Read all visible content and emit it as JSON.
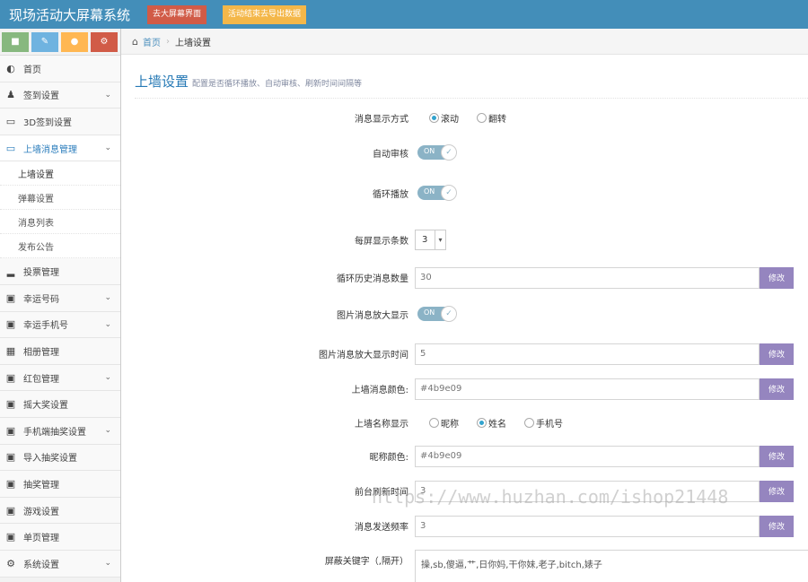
{
  "header": {
    "brand": "现场活动大屏幕系统",
    "btn_screen": "去大屏幕界面",
    "btn_export": "活动结束去导出数据"
  },
  "shortcuts": [
    "comment-icon",
    "pencil-icon",
    "users-icon",
    "cogs-icon"
  ],
  "sidebar": {
    "items": [
      {
        "label": "首页",
        "icon": "dashboard-icon"
      },
      {
        "label": "签到设置",
        "icon": "users-icon"
      },
      {
        "label": "3D签到设置",
        "icon": "desktop-icon"
      },
      {
        "label": "上墙消息管理",
        "icon": "desktop-icon"
      },
      {
        "label": "投票管理",
        "icon": "signal-icon"
      },
      {
        "label": "幸运号码",
        "icon": "gift-icon"
      },
      {
        "label": "幸运手机号",
        "icon": "gift-icon"
      },
      {
        "label": "相册管理",
        "icon": "picture-icon"
      },
      {
        "label": "红包管理",
        "icon": "gift-icon"
      },
      {
        "label": "摇大奖设置",
        "icon": "gift-icon"
      },
      {
        "label": "手机端抽奖设置",
        "icon": "gift-icon"
      },
      {
        "label": "导入抽奖设置",
        "icon": "gift-icon"
      },
      {
        "label": "抽奖管理",
        "icon": "gift-icon"
      },
      {
        "label": "游戏设置",
        "icon": "gift-icon"
      },
      {
        "label": "单页管理",
        "icon": "gift-icon"
      },
      {
        "label": "系统设置",
        "icon": "cog-icon"
      }
    ],
    "sub_items": [
      "上墙设置",
      "弹幕设置",
      "消息列表",
      "发布公告"
    ]
  },
  "breadcrumb": {
    "home": "首页",
    "current": "上墙设置"
  },
  "page": {
    "title": "上墙设置",
    "subtitle": "配置是否循环播放、自动审核、刷新时间间隔等"
  },
  "form": {
    "display_mode": {
      "label": "消息显示方式",
      "options": [
        "滚动",
        "翻转"
      ],
      "selected": "滚动"
    },
    "auto_review": {
      "label": "自动审核",
      "state": "ON"
    },
    "loop_play": {
      "label": "循环播放",
      "state": "ON"
    },
    "per_screen": {
      "label": "每屏显示条数",
      "value": "3"
    },
    "history_count": {
      "label": "循环历史消息数量",
      "value": "30",
      "button": "修改"
    },
    "image_zoom": {
      "label": "图片消息放大显示",
      "state": "ON"
    },
    "image_zoom_time": {
      "label": "图片消息放大显示时间",
      "value": "5",
      "button": "修改"
    },
    "msg_color": {
      "label": "上墙消息颜色:",
      "value": "#4b9e09",
      "button": "修改"
    },
    "name_display": {
      "label": "上墙名称显示",
      "options": [
        "昵称",
        "姓名",
        "手机号"
      ],
      "selected": "姓名"
    },
    "nick_color": {
      "label": "昵称颜色:",
      "value": "#4b9e09",
      "button": "修改"
    },
    "refresh_time": {
      "label": "前台刷新时间",
      "value": "3",
      "button": "修改"
    },
    "send_freq": {
      "label": "消息发送频率",
      "value": "3",
      "button": "修改"
    },
    "block_words": {
      "label": "屏蔽关键字（,隔开）",
      "value": "操,sb,傻逼,艹,日你妈,干你妹,老子,bitch,婊子"
    }
  },
  "watermark": "https://www.huzhan.com/ishop21448",
  "colors": {
    "header": "#438eb9",
    "accent": "#2679b5",
    "addon": "#9585bf",
    "switch": "#8bb3c6"
  }
}
